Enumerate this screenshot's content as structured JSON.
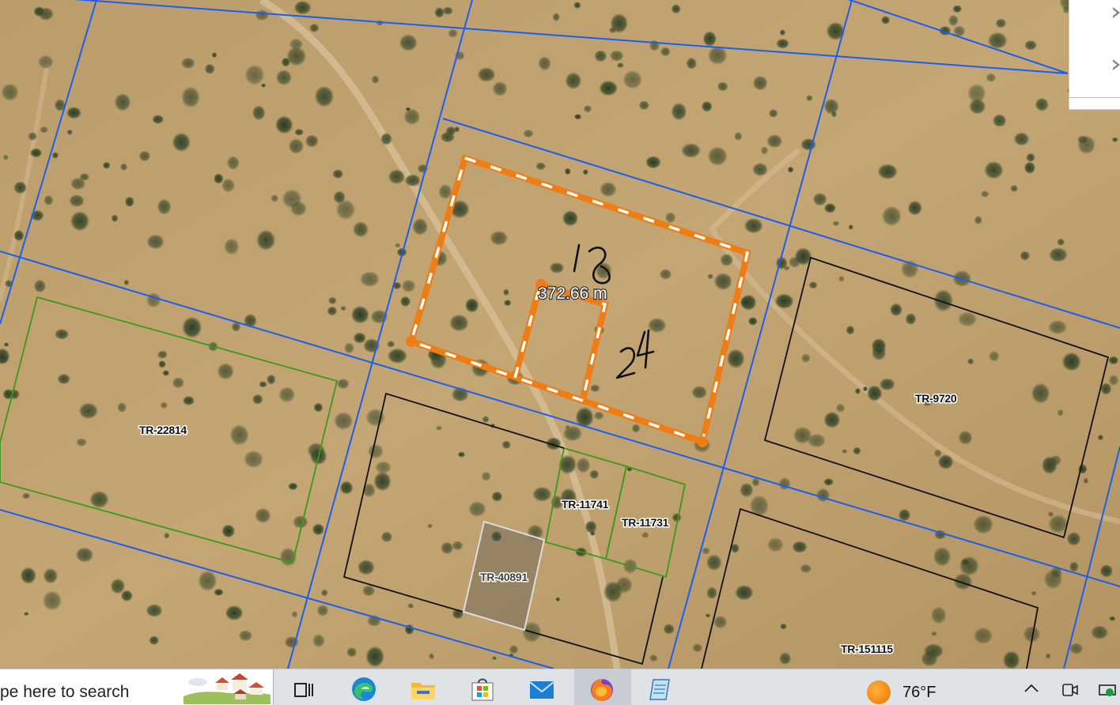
{
  "map": {
    "measurement_label": "372.66 m",
    "handwritten": [
      "18",
      "24"
    ],
    "parcels": [
      {
        "id": "TR-22814",
        "border": "green"
      },
      {
        "id": "TR-11741",
        "border": "green"
      },
      {
        "id": "TR-11731",
        "border": "green"
      },
      {
        "id": "TR-40891",
        "border": "gray"
      },
      {
        "id": "TR-9720",
        "border": "black"
      },
      {
        "id": "TR-151115",
        "border": "black"
      }
    ],
    "colors": {
      "grid_line": "#1a5ef0",
      "green_parcel": "#3a9a1a",
      "black_parcel": "#111111",
      "selection_orange": "#f07c14",
      "selection_dash": "#ffffff"
    }
  },
  "side_panel": {
    "buttons": [
      {
        "icon": "chevron-right-icon"
      },
      {
        "icon": "chevron-right-icon"
      }
    ]
  },
  "taskbar": {
    "search_placeholder": "pe here to search",
    "apps": [
      {
        "name": "task-view-icon"
      },
      {
        "name": "edge-icon"
      },
      {
        "name": "file-explorer-icon"
      },
      {
        "name": "microsoft-store-icon"
      },
      {
        "name": "mail-icon"
      },
      {
        "name": "firefox-icon",
        "active": true
      },
      {
        "name": "notepad-icon"
      }
    ],
    "weather": {
      "temp": "76°F",
      "icon": "sun-icon"
    },
    "tray": [
      {
        "icon": "chevron-up-icon"
      },
      {
        "icon": "meet-now-icon"
      },
      {
        "icon": "battery-icon"
      }
    ]
  }
}
